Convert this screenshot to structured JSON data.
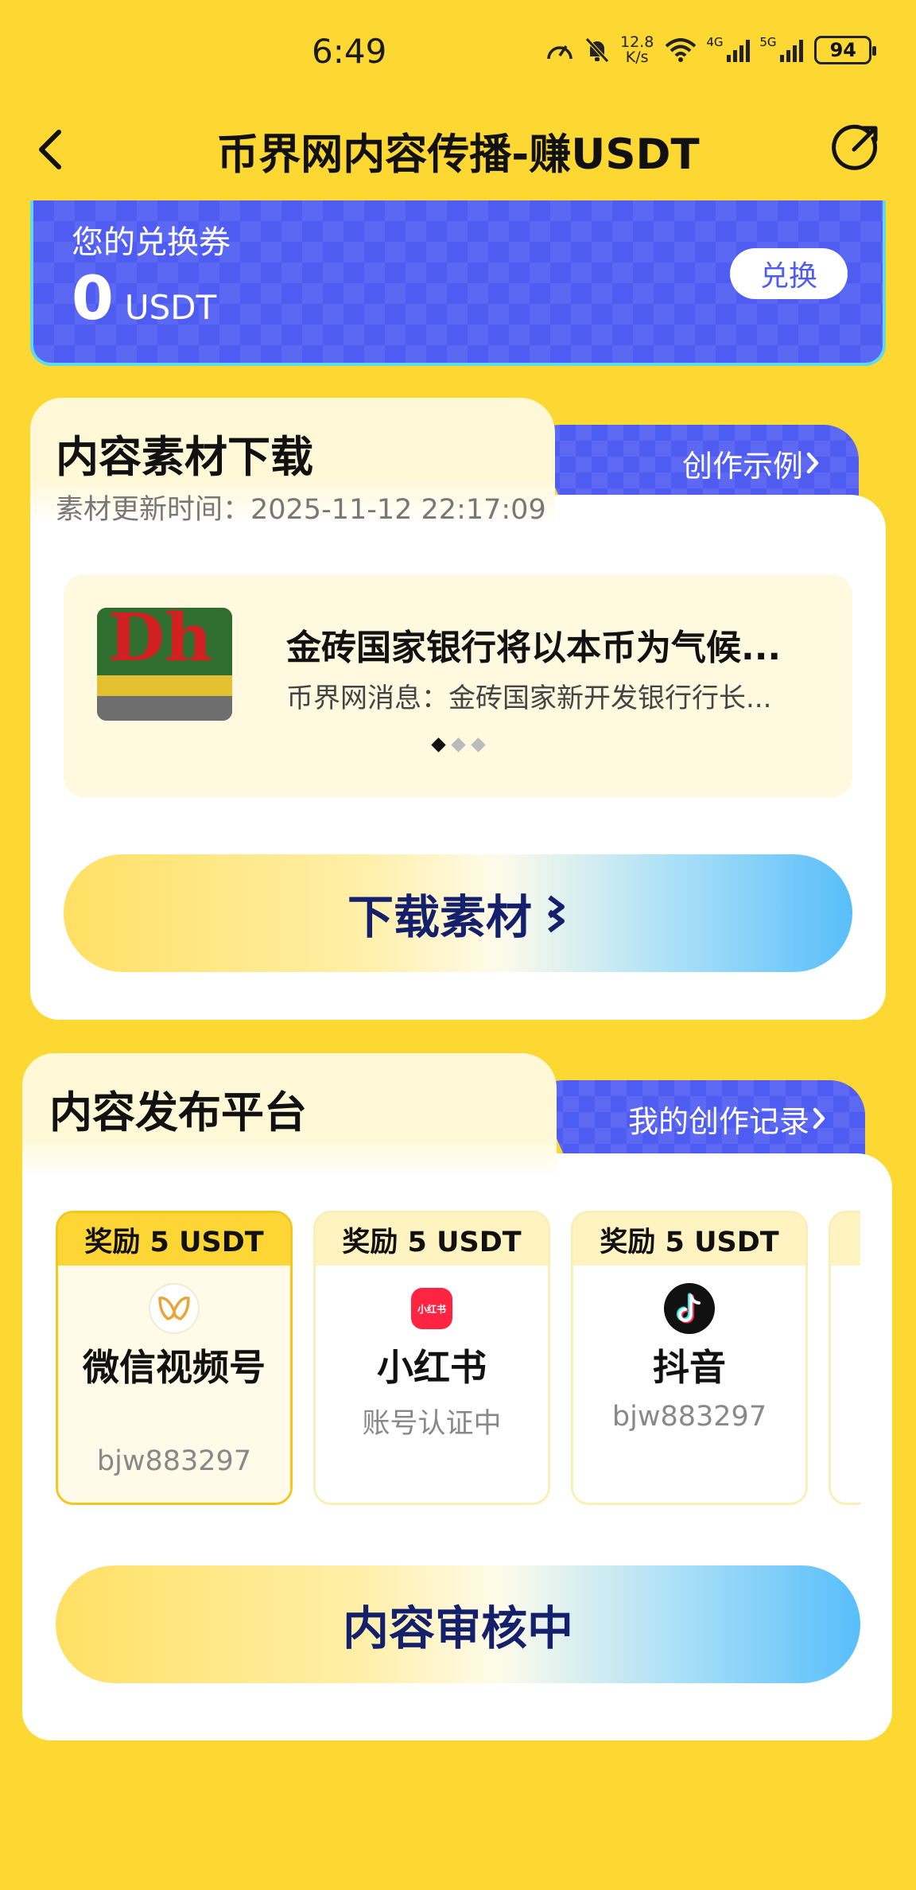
{
  "status_bar": {
    "time": "6:49",
    "net_speed_value": "12.8",
    "net_speed_unit": "K/s",
    "signal1_label": "4G",
    "signal2_label": "5G",
    "battery": "94"
  },
  "header": {
    "title": "币界网内容传播-赚USDT"
  },
  "coupon": {
    "label": "您的兑换券",
    "value": "0",
    "unit": "USDT",
    "redeem_label": "兑换"
  },
  "material_section": {
    "title": "内容素材下载",
    "update_time": "素材更新时间：2025-11-12 22:17:09",
    "examples_label": "创作示例",
    "article": {
      "title": "金砖国家银行将以本币为气候...",
      "summary": "币界网消息：金砖国家新开发银行行长..."
    },
    "download_label": "下载素材"
  },
  "publish_section": {
    "title": "内容发布平台",
    "records_label": "我的创作记录",
    "platforms": [
      {
        "reward": "奖励 5 USDT",
        "name": "微信视频号",
        "status": "bjw883297",
        "icon": "wechat-channels-icon"
      },
      {
        "reward": "奖励 5 USDT",
        "name": "小红书",
        "status": "账号认证中",
        "icon": "xiaohongshu-icon",
        "icon_text": "小红书"
      },
      {
        "reward": "奖励 5 USDT",
        "name": "抖音",
        "status": "bjw883297",
        "icon": "douyin-icon"
      }
    ],
    "review_label": "内容审核中"
  },
  "colors": {
    "background": "#FDD832",
    "accent_blue": "#4F5CF2",
    "button_text": "#14206B"
  }
}
